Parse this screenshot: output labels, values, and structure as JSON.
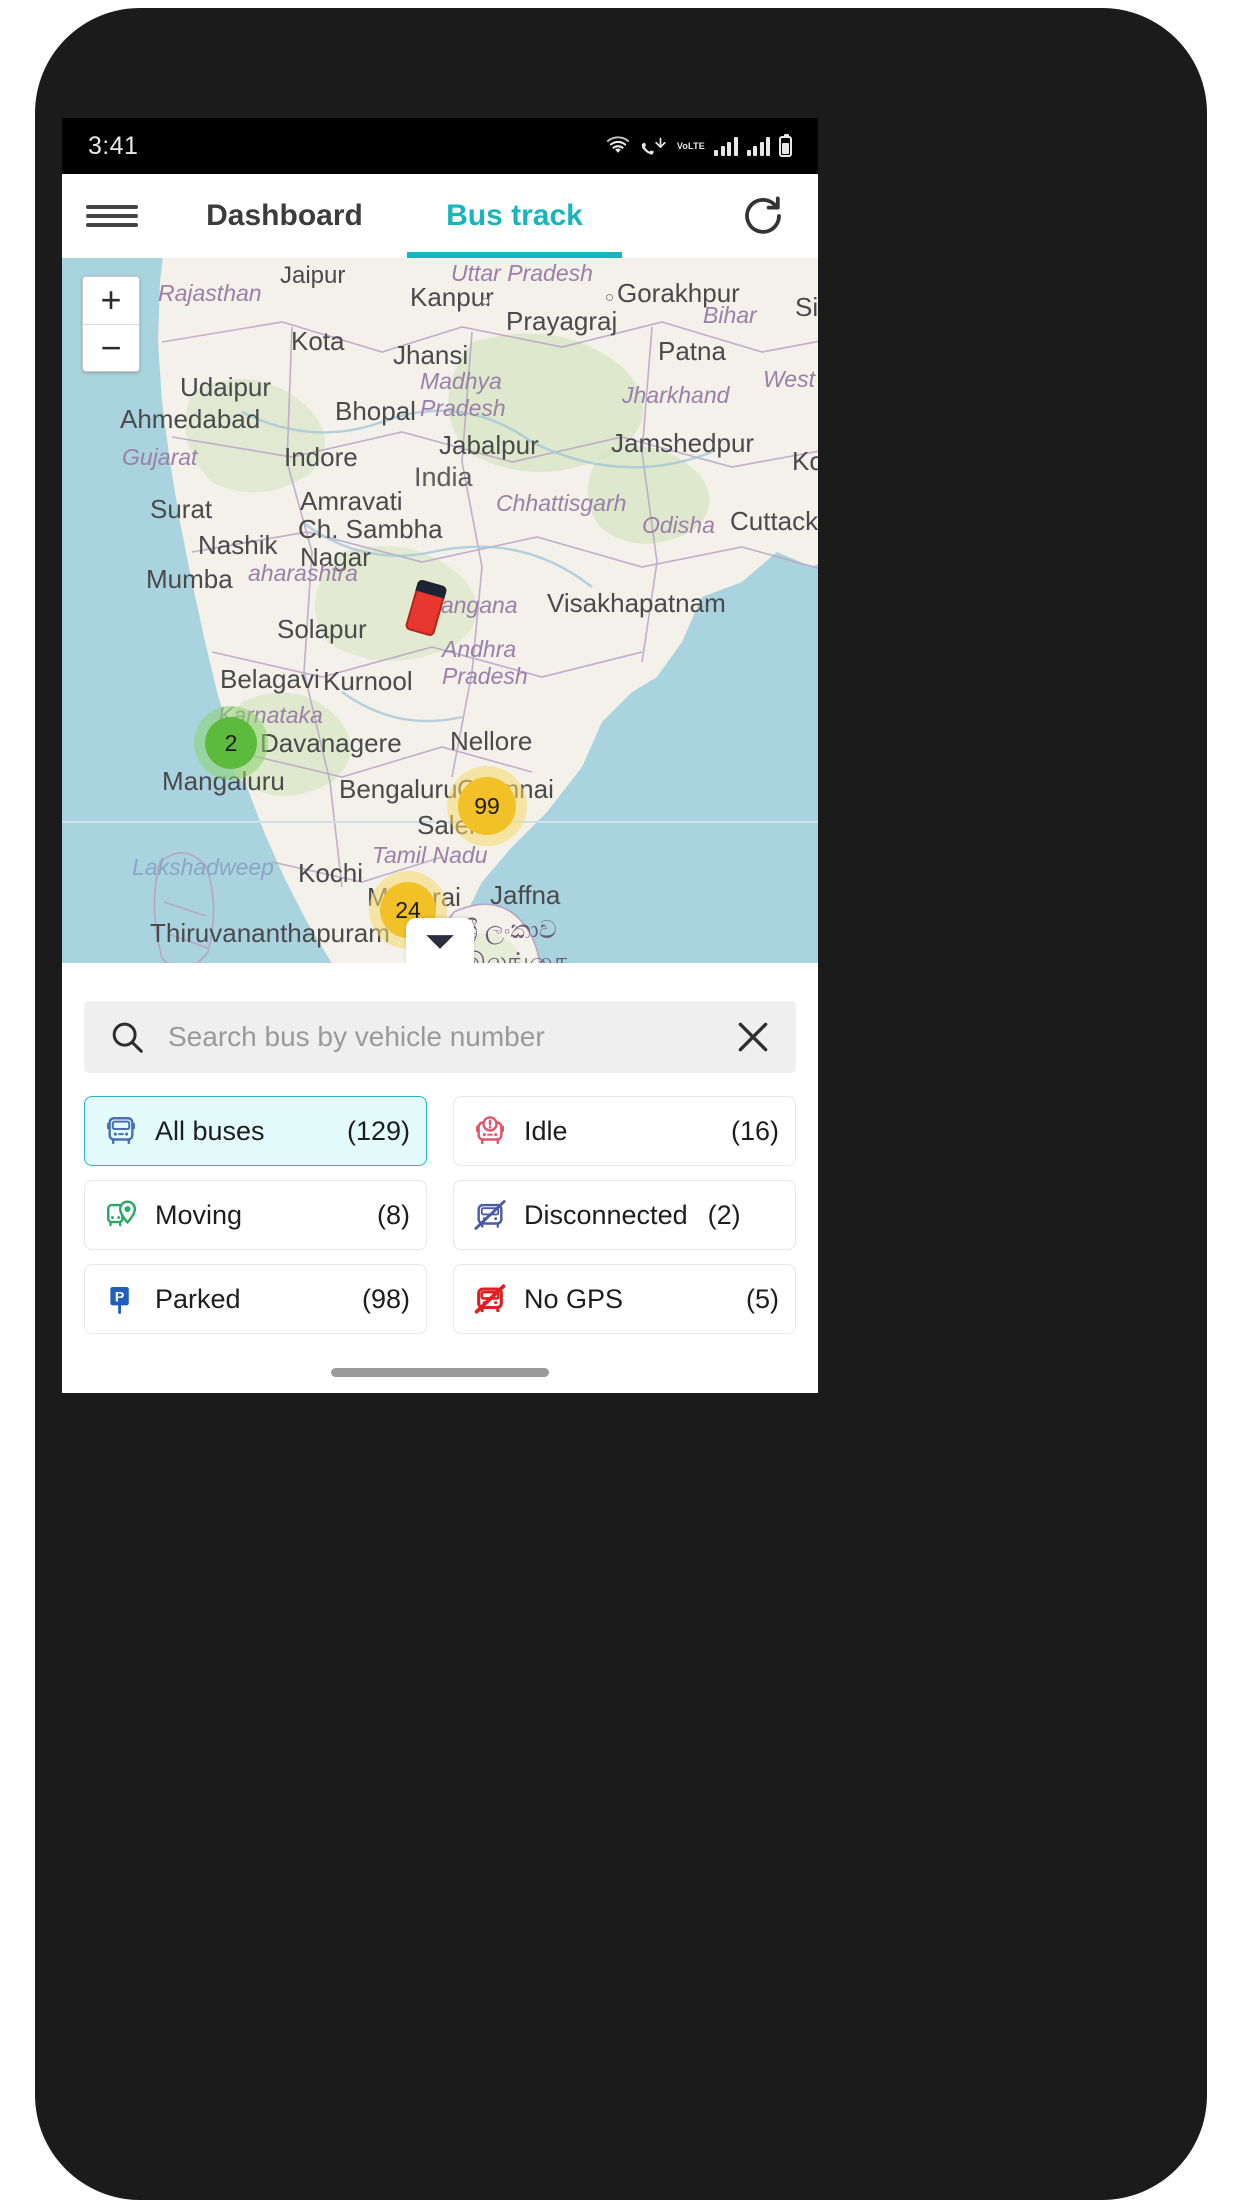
{
  "status_bar": {
    "time": "3:41",
    "icons": [
      "wifi-icon",
      "missed-call-icon",
      "volte-icon",
      "signal-bars-sim1-icon",
      "signal-bars-sim2-icon",
      "battery-icon"
    ],
    "volte_label": "VoLTE"
  },
  "app_bar": {
    "menu_icon": "hamburger-menu-icon",
    "tabs": [
      {
        "label": "Dashboard",
        "active": false
      },
      {
        "label": "Bus track",
        "active": true
      }
    ],
    "refresh_icon": "refresh-icon",
    "active_color": "#18b5bd"
  },
  "map": {
    "zoom_in_label": "+",
    "zoom_out_label": "−",
    "clusters": [
      {
        "count": "2",
        "color": "#4eba3c",
        "status": "moving"
      },
      {
        "count": "99",
        "color": "#f2c027",
        "status": "parked"
      },
      {
        "count": "24",
        "color": "#f2c027",
        "status": "parked"
      }
    ],
    "vehicle_marker": "bus-marker-icon",
    "cities": [
      "Jaipur",
      "Kanpur",
      "Gorakhpur",
      "Siliguri",
      "Kota",
      "Prayagraj",
      "Jhansi",
      "Patna",
      "Udaipur",
      "Bhopal",
      "Ahmedabad",
      "Indore",
      "Jabalpur",
      "Jamshedpur",
      "Kolkata",
      "Surat",
      "Amravati",
      "Cuttack",
      "Nashik",
      "Ch. Sambhajinagar",
      "Mumbai",
      "Visakhapatnam",
      "Solapur",
      "Belagavi",
      "Kurnool",
      "Davanagere",
      "Nellore",
      "Mangaluru",
      "Bengaluru",
      "Chennai",
      "Salem",
      "Kochi",
      "Madurai",
      "Jaffna",
      "Thiruvananthapuram"
    ],
    "regions": [
      "Rajasthan",
      "Uttar Pradesh",
      "Bihar",
      "Madhya Pradesh",
      "Jharkhand",
      "West Bengal",
      "Gujarat",
      "India",
      "Chhattisgarh",
      "Odisha",
      "Maharashtra",
      "Telangana",
      "Andhra Pradesh",
      "Karnataka",
      "Tamil Nadu",
      "Lakshadweep"
    ],
    "sheet_toggle_icon": "chevron-down-icon"
  },
  "search": {
    "icon": "search-icon",
    "placeholder": "Search bus by vehicle number",
    "value": "",
    "clear_icon": "close-icon"
  },
  "filters": [
    {
      "label": "All buses",
      "count": "(129)",
      "icon": "bus-icon",
      "color": "#4a6fb5",
      "selected": true
    },
    {
      "label": "Idle",
      "count": "(16)",
      "icon": "bus-idle-icon",
      "color": "#e0556a",
      "selected": false
    },
    {
      "label": "Moving",
      "count": "(8)",
      "icon": "bus-location-pin-icon",
      "color": "#29a864",
      "selected": false
    },
    {
      "label": "Disconnected",
      "count": "(2)",
      "icon": "bus-disconnected-icon",
      "color": "#4a5ba5",
      "selected": false
    },
    {
      "label": "Parked",
      "count": "(98)",
      "icon": "parking-sign-icon",
      "color": "#1f5fc0",
      "selected": false
    },
    {
      "label": "No GPS",
      "count": "(5)",
      "icon": "bus-no-gps-icon",
      "color": "#e02020",
      "selected": false
    }
  ]
}
